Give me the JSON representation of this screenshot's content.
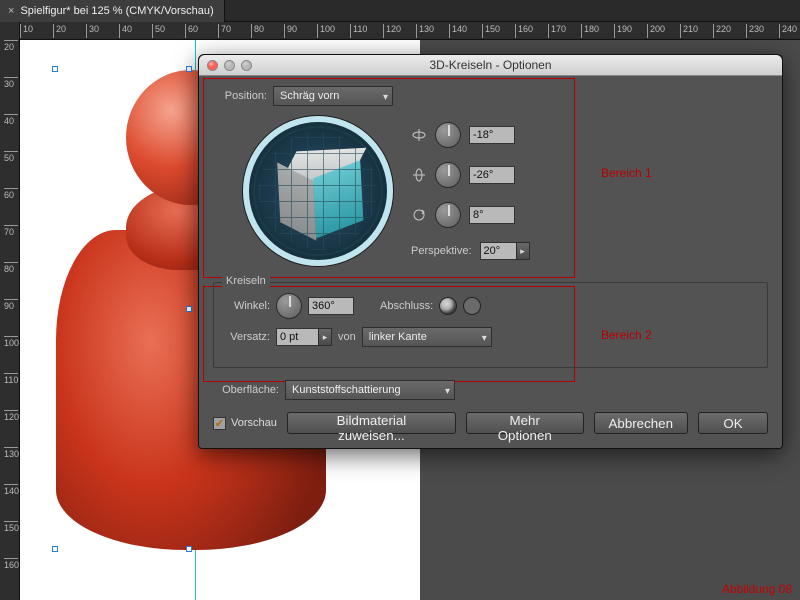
{
  "tab": {
    "title": "Spielfigur* bei 125 % (CMYK/Vorschau)"
  },
  "ruler_h": [
    "10",
    "20",
    "30",
    "40",
    "50",
    "60",
    "70",
    "80",
    "90",
    "100",
    "110",
    "120",
    "130",
    "140",
    "150",
    "160",
    "170",
    "180",
    "190",
    "200",
    "210",
    "220",
    "230",
    "240"
  ],
  "ruler_v": [
    "20",
    "30",
    "40",
    "50",
    "60",
    "70",
    "80",
    "90",
    "100",
    "110",
    "120",
    "130",
    "140",
    "150",
    "160"
  ],
  "dialog": {
    "title": "3D-Kreiseln - Optionen",
    "position_label": "Position:",
    "position_value": "Schräg vorn",
    "rot_x": "-18°",
    "rot_y": "-26°",
    "rot_z": "8°",
    "perspective_label": "Perspektive:",
    "perspective_value": "20°",
    "kreiseln_legend": "Kreiseln",
    "winkel_label": "Winkel:",
    "winkel_value": "360°",
    "abschluss_label": "Abschluss:",
    "versatz_label": "Versatz:",
    "versatz_value": "0 pt",
    "von_label": "von",
    "von_value": "linker Kante",
    "surface_label": "Oberfläche:",
    "surface_value": "Kunststoffschattierung",
    "preview_label": "Vorschau",
    "btn_map": "Bildmaterial zuweisen...",
    "btn_more": "Mehr Optionen",
    "btn_cancel": "Abbrechen",
    "btn_ok": "OK"
  },
  "annotations": {
    "area1": "Bereich 1",
    "area2": "Bereich 2",
    "caption": "Abbildung 08"
  },
  "colors": {
    "pawn": "#c9341b",
    "anno": "#b80000",
    "cube_face": "#3fa9b5"
  }
}
